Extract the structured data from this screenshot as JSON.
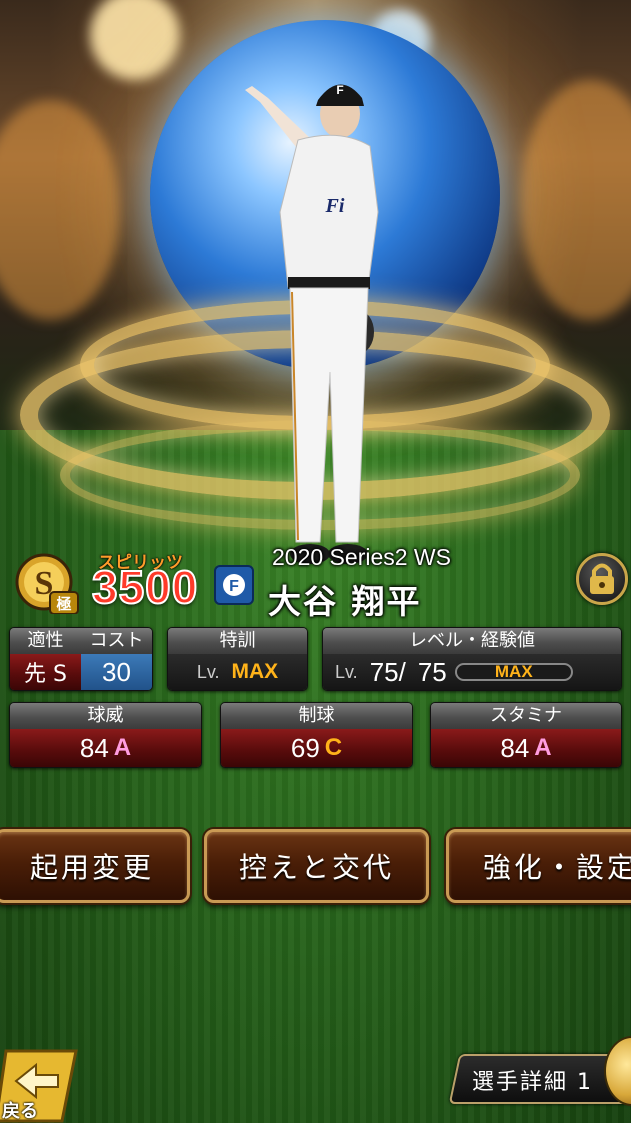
{
  "card": {
    "rank": "S",
    "rank_sub": "極",
    "spirits_label": "スピリッツ",
    "spirits_value": "3500",
    "team_letter": "F",
    "series": "2020 Series2 WS",
    "player_name": "大谷 翔平"
  },
  "stats_top": {
    "aptitude_label": "適性",
    "aptitude_value": "先 S",
    "cost_label": "コスト",
    "cost_value": "30",
    "training_label": "特訓",
    "training_lv": "Lv.",
    "training_value": "MAX",
    "level_label": "レベル・経験値",
    "level_lv": "Lv.",
    "level_current": "75/",
    "level_max": "75",
    "exp_value": "MAX"
  },
  "stats_bottom": [
    {
      "label": "球威",
      "value": "84",
      "grade": "A",
      "grade_color": "#ff9de0"
    },
    {
      "label": "制球",
      "value": "69",
      "grade": "C",
      "grade_color": "#ffb31a"
    },
    {
      "label": "スタミナ",
      "value": "84",
      "grade": "A",
      "grade_color": "#ff9de0"
    }
  ],
  "actions": {
    "lineup": "起用変更",
    "bench": "控えと交代",
    "enhance": "強化・設定"
  },
  "footer": {
    "back": "戻る",
    "detail": "選手詳細 1"
  }
}
